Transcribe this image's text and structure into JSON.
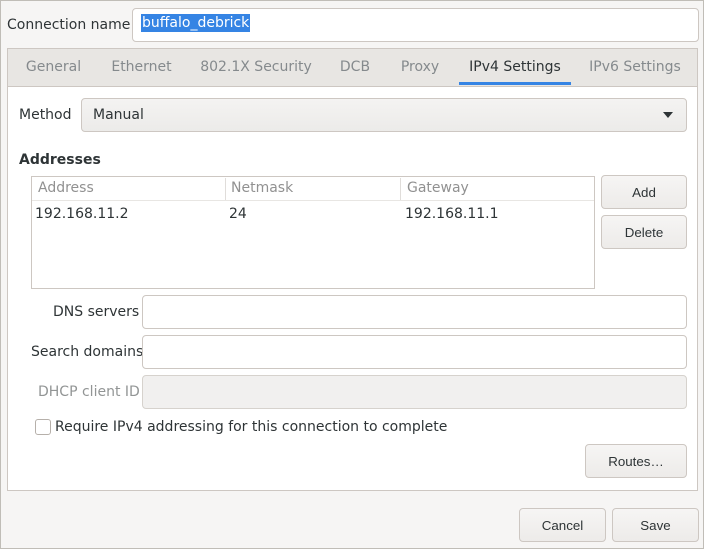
{
  "connection": {
    "label": "Connection name",
    "value": "buffalo_debrick"
  },
  "tabs": [
    {
      "label": "General"
    },
    {
      "label": "Ethernet"
    },
    {
      "label": "802.1X Security"
    },
    {
      "label": "DCB"
    },
    {
      "label": "Proxy"
    },
    {
      "label": "IPv4 Settings",
      "active": true
    },
    {
      "label": "IPv6 Settings"
    }
  ],
  "method": {
    "label": "Method",
    "value": "Manual"
  },
  "addresses": {
    "heading": "Addresses",
    "columns": [
      "Address",
      "Netmask",
      "Gateway"
    ],
    "rows": [
      [
        "192.168.11.2",
        "24",
        "192.168.11.1"
      ]
    ],
    "add_label": "Add",
    "delete_label": "Delete"
  },
  "dns": {
    "label": "DNS servers",
    "value": ""
  },
  "search_domains": {
    "label": "Search domains",
    "value": ""
  },
  "dhcp_client_id": {
    "label": "DHCP client ID",
    "value": ""
  },
  "require_ipv4": {
    "label": "Require IPv4 addressing for this connection to complete",
    "checked": false
  },
  "routes_label": "Routes…",
  "footer": {
    "cancel_label": "Cancel",
    "save_label": "Save"
  },
  "colors": {
    "accent": "#3584e4",
    "window_bg": "#f6f5f4"
  }
}
